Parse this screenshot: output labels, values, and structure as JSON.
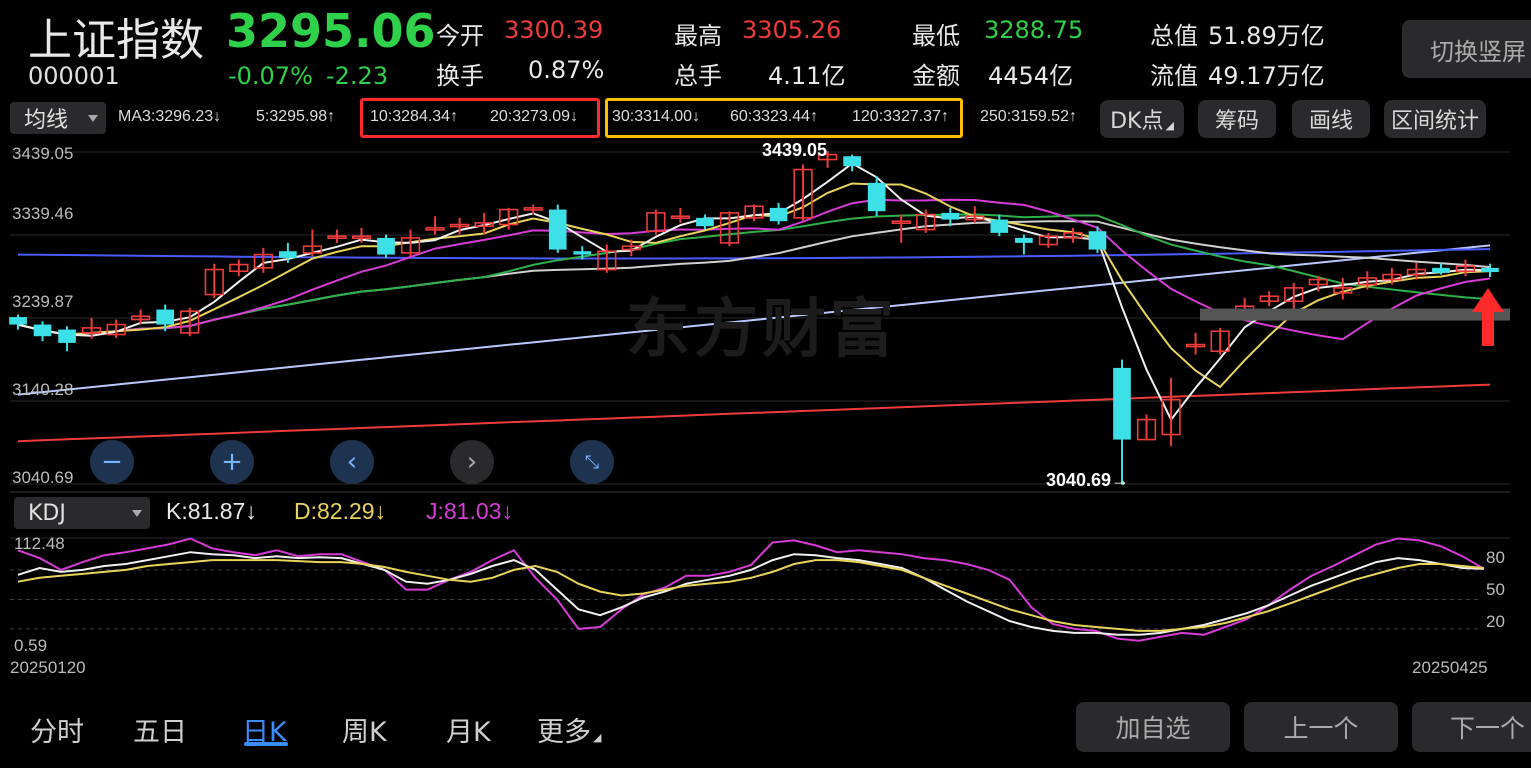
{
  "header": {
    "title": "上证指数",
    "code": "000001",
    "price": "3295.06",
    "change_pct": "-0.07%",
    "change": "-2.23",
    "stats": [
      {
        "label": "今开",
        "value": "3300.39",
        "color": "#ee3b3b"
      },
      {
        "label": "换手",
        "value": "0.87%",
        "color": "#e8e8e8"
      },
      {
        "label": "最高",
        "value": "3305.26",
        "color": "#ee3b3b"
      },
      {
        "label": "总手",
        "value": "4.11亿",
        "color": "#e8e8e8"
      },
      {
        "label": "最低",
        "value": "3288.75",
        "color": "#2fd04a"
      },
      {
        "label": "金额",
        "value": "4454亿",
        "color": "#e8e8e8"
      },
      {
        "label": "总值",
        "value": "51.89万亿",
        "color": "#e8e8e8"
      },
      {
        "label": "流值",
        "value": "49.17万亿",
        "color": "#e8e8e8"
      }
    ],
    "switch_button": "切换竖屏"
  },
  "ma_bar": {
    "selector": "均线",
    "items": [
      {
        "text": "MA3:3296.23↓",
        "color": "#e0e0e0"
      },
      {
        "text": "5:3295.98↑",
        "color": "#e8d45a"
      },
      {
        "text": "10:3284.34↑",
        "color": "#d63cd6"
      },
      {
        "text": "20:3273.09↓",
        "color": "#2fb04a"
      },
      {
        "text": "30:3314.00↓",
        "color": "#d0d0d0"
      },
      {
        "text": "60:3323.44↑",
        "color": "#4a5cff"
      },
      {
        "text": "120:3327.37↑",
        "color": "#b8c8ff"
      },
      {
        "text": "250:3159.52↑",
        "color": "#ee3b3b"
      }
    ],
    "tools": [
      "DK点",
      "筹码",
      "画线",
      "区间统计"
    ]
  },
  "main_chart": {
    "y_labels": [
      "3439.05",
      "3339.46",
      "3239.87",
      "3140.28",
      "3040.69"
    ],
    "high_annotation": "3439.05",
    "low_annotation": "3040.69→",
    "watermark": "东方财富"
  },
  "kdj": {
    "selector": "KDJ",
    "k": "K:81.87↓",
    "d": "D:82.29↓",
    "j": "J:81.03↓",
    "y_top": "112.48",
    "y_bottom": "0.59",
    "levels": [
      "80",
      "50",
      "20"
    ],
    "date_start": "20250120",
    "date_end": "20250425"
  },
  "chart_data": {
    "type": "candlestick",
    "title": "上证指数",
    "ylim": [
      3040.69,
      3439.05
    ],
    "candles": [
      [
        3241,
        3232,
        3244,
        3226
      ],
      [
        3232,
        3218,
        3236,
        3212
      ],
      [
        3226,
        3210,
        3230,
        3200
      ],
      [
        3222,
        3228,
        3240,
        3215
      ],
      [
        3220,
        3232,
        3238,
        3216
      ],
      [
        3238,
        3242,
        3250,
        3232
      ],
      [
        3250,
        3232,
        3256,
        3224
      ],
      [
        3222,
        3248,
        3252,
        3218
      ],
      [
        3268,
        3298,
        3305,
        3264
      ],
      [
        3296,
        3304,
        3310,
        3290
      ],
      [
        3300,
        3316,
        3324,
        3294
      ],
      [
        3320,
        3312,
        3330,
        3306
      ],
      [
        3318,
        3326,
        3346,
        3314
      ],
      [
        3336,
        3338,
        3346,
        3330
      ],
      [
        3338,
        3338,
        3348,
        3330
      ],
      [
        3336,
        3316,
        3340,
        3312
      ],
      [
        3318,
        3336,
        3346,
        3314
      ],
      [
        3348,
        3348,
        3362,
        3340
      ],
      [
        3352,
        3352,
        3360,
        3340
      ],
      [
        3350,
        3354,
        3366,
        3340
      ],
      [
        3352,
        3370,
        3372,
        3346
      ],
      [
        3370,
        3372,
        3376,
        3364
      ],
      [
        3370,
        3322,
        3376,
        3318
      ],
      [
        3320,
        3316,
        3326,
        3310
      ],
      [
        3298,
        3320,
        3328,
        3294
      ],
      [
        3322,
        3326,
        3334,
        3314
      ],
      [
        3344,
        3366,
        3370,
        3340
      ],
      [
        3362,
        3362,
        3372,
        3354
      ],
      [
        3360,
        3350,
        3364,
        3346
      ],
      [
        3330,
        3366,
        3368,
        3326
      ],
      [
        3360,
        3374,
        3376,
        3356
      ],
      [
        3372,
        3356,
        3378,
        3352
      ],
      [
        3360,
        3418,
        3424,
        3356
      ],
      [
        3430,
        3436,
        3440,
        3420
      ],
      [
        3434,
        3422,
        3436,
        3416
      ],
      [
        3402,
        3368,
        3410,
        3362
      ],
      [
        3354,
        3356,
        3364,
        3330
      ],
      [
        3346,
        3364,
        3370,
        3342
      ],
      [
        3366,
        3358,
        3372,
        3350
      ],
      [
        3358,
        3362,
        3374,
        3354
      ],
      [
        3358,
        3342,
        3364,
        3338
      ],
      [
        3336,
        3330,
        3340,
        3316
      ],
      [
        3328,
        3338,
        3342,
        3324
      ],
      [
        3336,
        3342,
        3348,
        3330
      ],
      [
        3344,
        3322,
        3350,
        3318
      ],
      [
        3180,
        3094,
        3190,
        3040
      ],
      [
        3094,
        3118,
        3124,
        3094
      ],
      [
        3100,
        3142,
        3168,
        3086
      ],
      [
        3206,
        3208,
        3222,
        3196
      ],
      [
        3200,
        3224,
        3228,
        3196
      ],
      [
        3248,
        3254,
        3264,
        3242
      ],
      [
        3260,
        3266,
        3272,
        3254
      ],
      [
        3260,
        3276,
        3282,
        3248
      ],
      [
        3280,
        3286,
        3290,
        3272
      ],
      [
        3270,
        3276,
        3288,
        3262
      ],
      [
        3280,
        3288,
        3296,
        3274
      ],
      [
        3286,
        3292,
        3300,
        3280
      ],
      [
        3292,
        3298,
        3306,
        3286
      ],
      [
        3300,
        3294,
        3306,
        3292
      ],
      [
        3296,
        3302,
        3310,
        3290
      ],
      [
        3300,
        3295,
        3305,
        3289
      ]
    ],
    "series": [
      {
        "name": "MA3",
        "color": "#e8e8e8"
      },
      {
        "name": "5",
        "color": "#e8d45a"
      },
      {
        "name": "10",
        "color": "#d63cd6"
      },
      {
        "name": "20",
        "color": "#2fb04a"
      },
      {
        "name": "30",
        "color": "#d0d0d0"
      },
      {
        "name": "60",
        "color": "#4a5cff"
      },
      {
        "name": "120",
        "color": "#b8c8ff"
      },
      {
        "name": "250",
        "color": "#ee3b3b"
      }
    ]
  },
  "nav": {
    "tabs": [
      "分时",
      "五日",
      "日K",
      "周K",
      "月K",
      "更多"
    ],
    "active": "日K",
    "buttons": [
      "加自选",
      "上一个",
      "下一个"
    ]
  }
}
